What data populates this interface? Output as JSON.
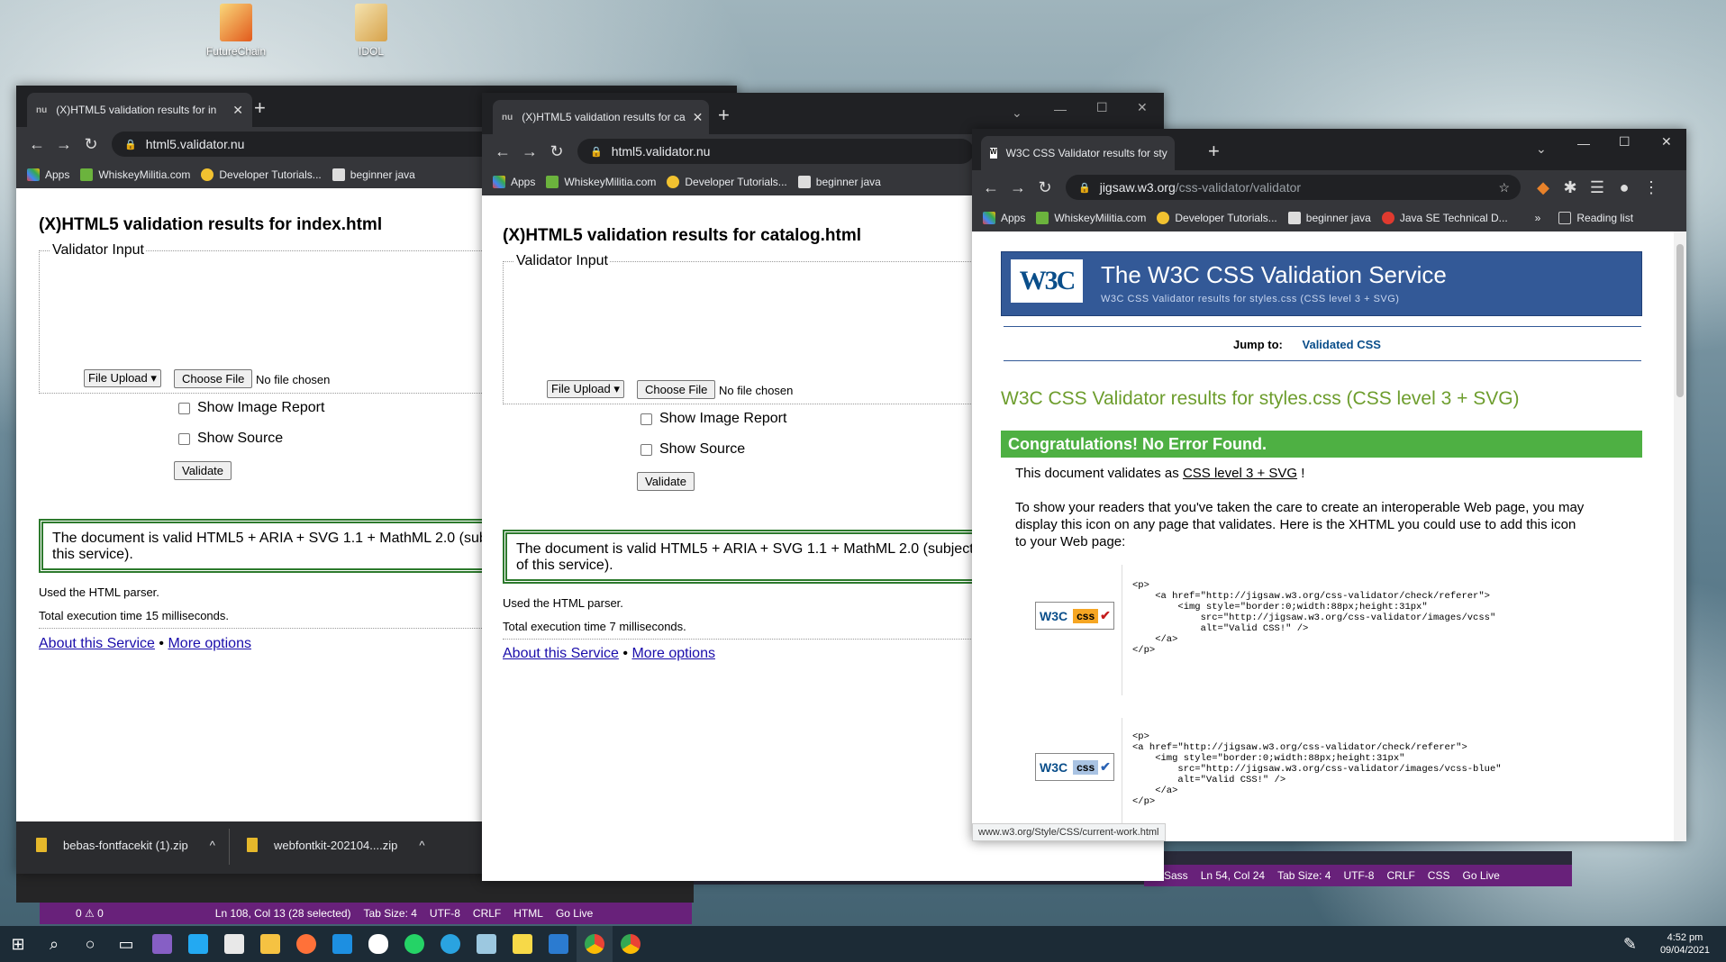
{
  "desktop": {
    "icons": [
      {
        "label": "FutureChain"
      },
      {
        "label": "IDOL"
      }
    ]
  },
  "win1": {
    "tab_title": "(X)HTML5 validation results for in",
    "tab_favicon": "nu",
    "url": "html5.validator.nu",
    "bookmarks": [
      "Apps",
      "WhiskeyMilitia.com",
      "Developer Tutorials...",
      "beginner java"
    ],
    "heading": "(X)HTML5 validation results for index.html",
    "legend": "Validator Input",
    "select_value": "File Upload",
    "choose_file": "Choose File",
    "no_file": "No file chosen",
    "show_image_report": "Show Image Report",
    "show_source": "Show Source",
    "validate": "Validate",
    "success": "The document is valid HTML5 + ARIA + SVG 1.1 + MathML 2.0 (sub",
    "success2": "this service).",
    "parser": "Used the HTML parser.",
    "exec_time": "Total execution time 15 milliseconds.",
    "about": "About this Service",
    "bullet": "•",
    "more": "More options",
    "downloads": [
      "bebas-fontfacekit (1).zip",
      "webfontkit-202104....zip"
    ]
  },
  "win2": {
    "tab_title": "(X)HTML5 validation results for ca",
    "tab_favicon": "nu",
    "url": "html5.validator.nu",
    "bookmarks": [
      "Apps",
      "WhiskeyMilitia.com",
      "Developer Tutorials...",
      "beginner java"
    ],
    "heading": "(X)HTML5 validation results for catalog.html",
    "legend": "Validator Input",
    "select_value": "File Upload",
    "choose_file": "Choose File",
    "no_file": "No file chosen",
    "show_image_report": "Show Image Report",
    "show_source": "Show Source",
    "validate": "Validate",
    "success": "The document is valid HTML5 + ARIA + SVG 1.1 + MathML 2.0 (subject",
    "success2": "of this service).",
    "parser": "Used the HTML parser.",
    "exec_time": "Total execution time 7 milliseconds.",
    "about": "About this Service",
    "bullet": "•",
    "more": "More options"
  },
  "win3": {
    "tab_title": "W3C CSS Validator results for sty",
    "url_host": "jigsaw.w3.org",
    "url_path": "/css-validator/validator",
    "bookmarks": [
      "Apps",
      "WhiskeyMilitia.com",
      "Developer Tutorials...",
      "beginner java",
      "Java SE Technical D..."
    ],
    "more_bookmarks": "»",
    "reading_list": "Reading list",
    "logo": "W3C",
    "title": "The W3C CSS Validation Service",
    "subtitle": "W3C CSS Validator results for styles.css (CSS level 3 + SVG)",
    "jump_label": "Jump to:",
    "jump_link": "Validated CSS",
    "results_heading": "W3C CSS Validator results for styles.css (CSS level 3 + SVG)",
    "congrats": "Congratulations! No Error Found.",
    "validates_prefix": "This document validates as ",
    "validates_link": "CSS level 3 + SVG",
    "validates_suffix": " !",
    "para1": "To show your readers that you've taken the care to create an interoperable Web page, you may",
    "para2": "display this icon on any page that validates. Here is the XHTML you could use to add this icon",
    "para3": "to your Web page:",
    "badge_w3c": "W3C",
    "badge_css": "css",
    "code1": "<p>\n    <a href=\"http://jigsaw.w3.org/css-validator/check/referer\">\n        <img style=\"border:0;width:88px;height:31px\"\n            src=\"http://jigsaw.w3.org/css-validator/images/vcss\"\n            alt=\"Valid CSS!\" />\n    </a>\n</p>",
    "code2": "<p>\n<a href=\"http://jigsaw.w3.org/css-validator/check/referer\">\n    <img style=\"border:0;width:88px;height:31px\"\n        src=\"http://jigsaw.w3.org/css-validator/images/vcss-blue\"\n        alt=\"Valid CSS!\" />\n    </a>\n</p>",
    "status_url": "www.w3.org/Style/CSS/current-work.html"
  },
  "vscode_status_left": {
    "items": [
      "0 ⚠ 0",
      "Ln 108, Col 13 (28 selected)",
      "Tab Size: 4",
      "UTF-8",
      "CRLF",
      "HTML",
      "Go Live"
    ]
  },
  "vscode_status_right": {
    "items": [
      "Sass",
      "Ln 54, Col 24",
      "Tab Size: 4",
      "UTF-8",
      "CRLF",
      "CSS",
      "Go Live"
    ]
  },
  "taskbar": {
    "time": "4:52 pm",
    "date": "09/04/2021"
  },
  "colors": {
    "w3c_green": "#4eb043",
    "w3c_title_green": "#6d9d2d",
    "vscode_purple": "#68217a"
  }
}
